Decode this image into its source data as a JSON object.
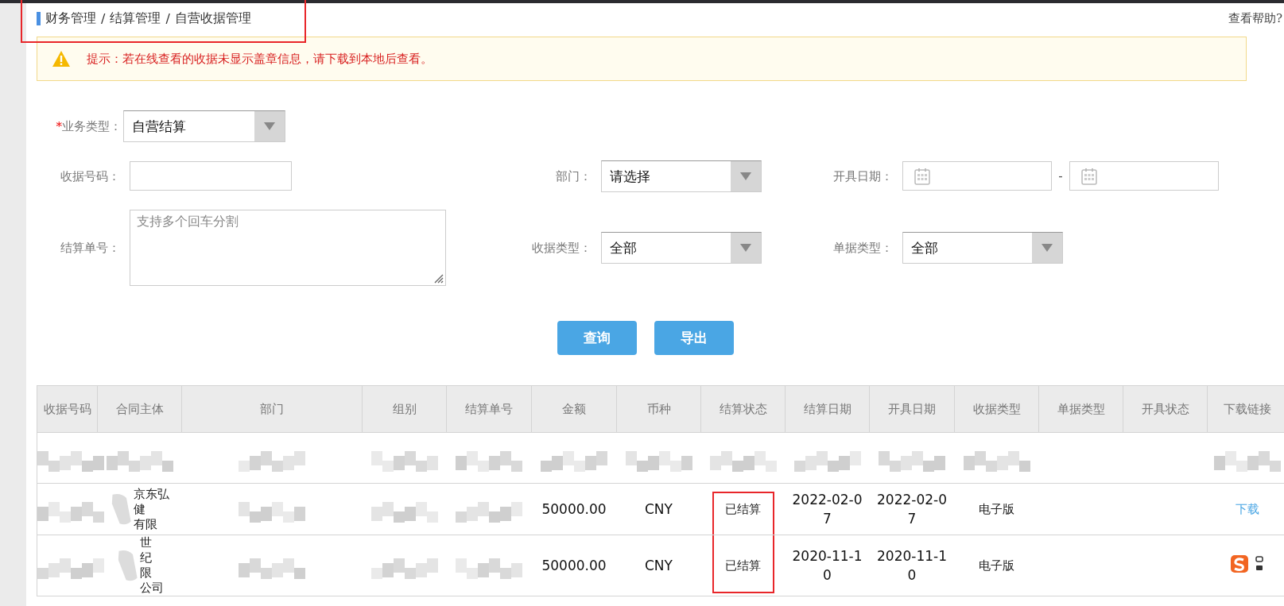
{
  "breadcrumb": {
    "items": [
      "财务管理",
      "结算管理",
      "自营收据管理"
    ],
    "separator": "/",
    "highlighted": true
  },
  "help_link": "查看帮助?",
  "notice": {
    "text": "提示：若在线查看的收据未显示盖章信息，请下载到本地后查看。"
  },
  "form": {
    "rows": [
      [
        {
          "kind": "select",
          "label": "业务类型：",
          "required_mark": "*",
          "value": "自营结算"
        }
      ],
      [
        {
          "kind": "text",
          "label": "收据号码："
        },
        {
          "kind": "select",
          "label": "部门：",
          "value": "请选择"
        },
        {
          "kind": "daterange",
          "label": "开具日期：",
          "separator": "-"
        }
      ],
      [
        {
          "kind": "textarea",
          "label": "结算单号：",
          "placeholder": "支持多个回车分割"
        },
        {
          "kind": "select",
          "label": "收据类型：",
          "value": "全部"
        },
        {
          "kind": "select",
          "label": "单据类型：",
          "value": "全部"
        }
      ]
    ]
  },
  "buttons": [
    {
      "label": "查询"
    },
    {
      "label": "导出"
    }
  ],
  "table": {
    "columns": [
      "收据号码",
      "合同主体",
      "部门",
      "组别",
      "结算单号",
      "金额",
      "币种",
      "结算状态",
      "结算日期",
      "开具日期",
      "收据类型",
      "单据类型",
      "开具状态",
      "下载链接"
    ],
    "rows": [
      {
        "cells": [
          {
            "kind": "redacted"
          },
          {
            "kind": "redacted"
          },
          {
            "kind": "redacted"
          },
          {
            "kind": "redacted"
          },
          {
            "kind": "redacted"
          },
          {
            "kind": "redacted"
          },
          {
            "kind": "redacted"
          },
          {
            "kind": "redacted"
          },
          {
            "kind": "redacted"
          },
          {
            "kind": "redacted"
          },
          {
            "kind": "redacted"
          },
          {
            "kind": "empty"
          },
          {
            "kind": "empty"
          },
          {
            "kind": "redacted"
          }
        ]
      },
      {
        "cells": [
          {
            "kind": "redacted"
          },
          {
            "kind": "partial",
            "lines": [
              "京东弘",
              "健",
              "有限"
            ]
          },
          {
            "kind": "redacted"
          },
          {
            "kind": "redacted"
          },
          {
            "kind": "redacted"
          },
          {
            "kind": "number",
            "text": "50000.00"
          },
          {
            "kind": "number",
            "text": "CNY"
          },
          {
            "kind": "text",
            "text": "已结算",
            "highlighted": true
          },
          {
            "kind": "number",
            "text": "2022-02-07"
          },
          {
            "kind": "number",
            "text": "2022-02-07"
          },
          {
            "kind": "text",
            "text": "电子版"
          },
          {
            "kind": "empty"
          },
          {
            "kind": "empty"
          },
          {
            "kind": "link",
            "text": "下载"
          }
        ]
      },
      {
        "cells": [
          {
            "kind": "redacted"
          },
          {
            "kind": "partial",
            "lines": [
              "世",
              "纪",
              "限",
              "公司"
            ]
          },
          {
            "kind": "redacted"
          },
          {
            "kind": "redacted"
          },
          {
            "kind": "redacted"
          },
          {
            "kind": "number",
            "text": "50000.00"
          },
          {
            "kind": "number",
            "text": "CNY"
          },
          {
            "kind": "text",
            "text": "已结算",
            "highlighted": true
          },
          {
            "kind": "number",
            "text": "2020-11-10"
          },
          {
            "kind": "number",
            "text": "2020-11-10"
          },
          {
            "kind": "text",
            "text": "电子版"
          },
          {
            "kind": "empty"
          },
          {
            "kind": "empty"
          },
          {
            "kind": "ime_icon"
          }
        ]
      }
    ]
  }
}
